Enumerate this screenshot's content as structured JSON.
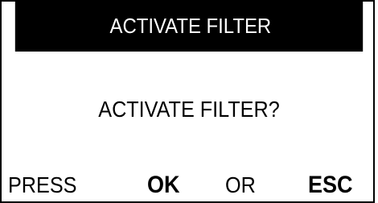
{
  "dialog": {
    "title": "ACTIVATE FILTER",
    "question": "ACTIVATE FILTER?",
    "prompt": {
      "press": "PRESS",
      "ok_key": "OK",
      "or": "OR",
      "esc_key": "ESC"
    }
  },
  "colors": {
    "title_bar_bg": "#000000",
    "title_text": "#ffffff",
    "body_bg": "#ffffff",
    "body_text": "#000000"
  }
}
